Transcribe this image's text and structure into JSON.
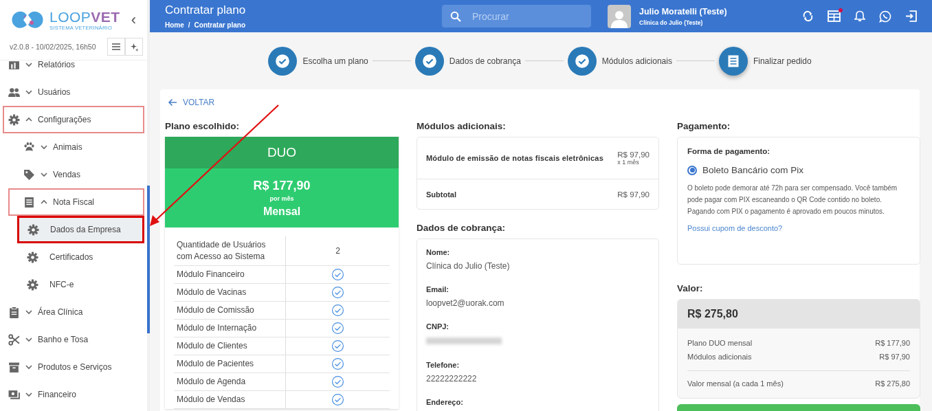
{
  "sidebar": {
    "logo": {
      "name_light": "LOOP",
      "name_bold": "VET",
      "tagline": "SISTEMA VETERINÁRIO"
    },
    "collapse_glyph": "‹",
    "version": "v2.0.8 - 10/02/2025, 16h50",
    "items": [
      {
        "label": "Relatórios",
        "expanded": false,
        "highlighted": false
      },
      {
        "label": "Usuários",
        "expanded": false,
        "highlighted": false
      },
      {
        "label": "Configurações",
        "expanded": true,
        "highlighted": true,
        "children": [
          {
            "label": "Animais",
            "expanded": false,
            "highlighted": false
          },
          {
            "label": "Vendas",
            "expanded": false,
            "highlighted": false
          },
          {
            "label": "Nota Fiscal",
            "expanded": true,
            "highlighted": true,
            "children": [
              {
                "label": "Dados da Empresa",
                "selected": true,
                "highlighted": true
              },
              {
                "label": "Certificados",
                "selected": false,
                "highlighted": false
              },
              {
                "label": "NFC-e",
                "selected": false,
                "highlighted": false
              }
            ]
          }
        ]
      },
      {
        "label": "Área Clínica",
        "expanded": false,
        "highlighted": false
      },
      {
        "label": "Banho e Tosa",
        "expanded": false,
        "highlighted": false
      },
      {
        "label": "Produtos e Serviços",
        "expanded": false,
        "highlighted": false
      },
      {
        "label": "Financeiro",
        "expanded": false,
        "highlighted": false
      }
    ]
  },
  "header": {
    "title": "Contratar plano",
    "breadcrumb": [
      "Home",
      "Contratar plano"
    ],
    "breadcrumb_separator": "/",
    "search": {
      "placeholder": "Procurar"
    },
    "user": {
      "name": "Julio Moratelli (Teste)",
      "clinic": "Clínica do Julio (Teste)"
    },
    "calendar_badge": true
  },
  "steps": [
    {
      "label": "Escolha um plano",
      "done": true
    },
    {
      "label": "Dados de cobrança",
      "done": true
    },
    {
      "label": "Módulos adicionais",
      "done": true
    },
    {
      "label": "Finalizar pedido",
      "done": false
    }
  ],
  "back_link": "VOLTAR",
  "plan": {
    "heading": "Plano escolhido:",
    "name": "DUO",
    "price": "R$ 177,90",
    "price_unit": "por mês",
    "period": "Mensal",
    "features": [
      {
        "label": "Quantidade de Usuários com Acesso ao Sistema",
        "kind": "text",
        "value": "2"
      },
      {
        "label": "Módulo Financeiro",
        "kind": "check"
      },
      {
        "label": "Módulo de Vacinas",
        "kind": "check"
      },
      {
        "label": "Módulo de Comissão",
        "kind": "check"
      },
      {
        "label": "Módulo de Internação",
        "kind": "check"
      },
      {
        "label": "Módulo de Clientes",
        "kind": "check"
      },
      {
        "label": "Módulo de Pacientes",
        "kind": "check"
      },
      {
        "label": "Módulo de Agenda",
        "kind": "check"
      },
      {
        "label": "Módulo de Vendas",
        "kind": "check"
      }
    ]
  },
  "modules": {
    "heading": "Módulos adicionais:",
    "items": [
      {
        "name": "Módulo de emissão de notas fiscais eletrônicas",
        "price": "R$ 97,90",
        "quantity": "x 1 mês"
      }
    ],
    "subtotal_label": "Subtotal",
    "subtotal": "R$ 97,90"
  },
  "billing": {
    "heading": "Dados de cobrança:",
    "fields": [
      {
        "label": "Nome:",
        "value": "Clínica do Julio (Teste)"
      },
      {
        "label": "Email:",
        "value": "loopvet2@uorak.com"
      },
      {
        "label": "CNPJ:",
        "redacted": true
      },
      {
        "label": "Telefone:",
        "value": "22222222222"
      },
      {
        "label": "Endereço:"
      }
    ]
  },
  "payment": {
    "heading": "Pagamento:",
    "method_label": "Forma de pagamento:",
    "options": [
      {
        "label": "Boleto Bancário com Pix",
        "selected": true
      }
    ],
    "description": "O boleto pode demorar até 72h para ser compensado. Você também pode pagar com PIX escaneando o QR Code contido no boleto. Pagando com PIX o pagamento é aprovado em poucos minutos.",
    "coupon_link": "Possui cupom de desconto?"
  },
  "total": {
    "heading": "Valor:",
    "amount": "R$ 275,80",
    "lines": [
      {
        "label": "Plano DUO mensal",
        "value": "R$ 177,90"
      },
      {
        "label": "Módulos adicionais",
        "value": "R$ 97,90"
      }
    ],
    "summary_label": "Valor mensal (a cada 1 mês)",
    "summary_value": "R$ 275,80"
  }
}
